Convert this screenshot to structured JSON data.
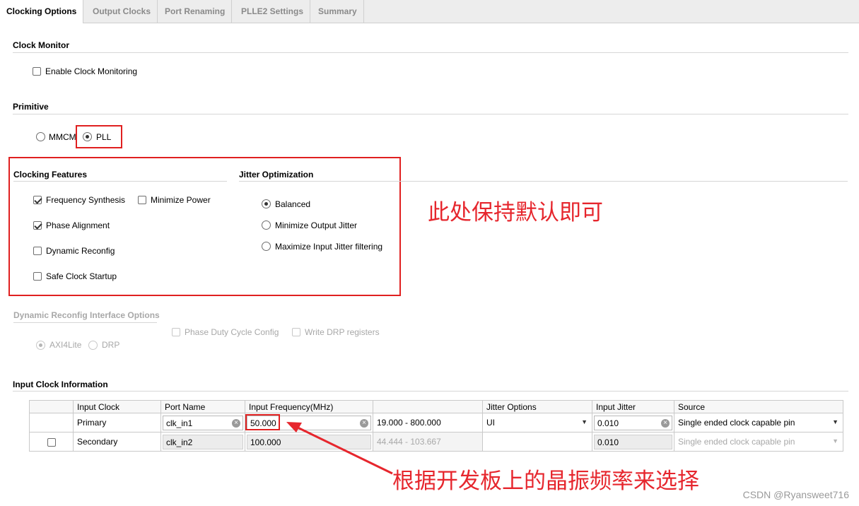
{
  "tabs": [
    {
      "label": "Clocking Options",
      "active": true
    },
    {
      "label": "Output Clocks",
      "active": false
    },
    {
      "label": "Port Renaming",
      "active": false
    },
    {
      "label": "PLLE2 Settings",
      "active": false
    },
    {
      "label": "Summary",
      "active": false
    }
  ],
  "clock_monitor": {
    "title": "Clock Monitor",
    "enable_label": "Enable Clock Monitoring",
    "enabled": false
  },
  "primitive": {
    "title": "Primitive",
    "options": [
      "MMCM",
      "PLL"
    ],
    "selected": "PLL"
  },
  "clocking_features": {
    "title": "Clocking Features",
    "frequency_synthesis": "Frequency Synthesis",
    "minimize_power": "Minimize Power",
    "phase_alignment": "Phase Alignment",
    "dynamic_reconfig": "Dynamic Reconfig",
    "safe_clock_startup": "Safe Clock Startup"
  },
  "jitter_optimization": {
    "title": "Jitter Optimization",
    "balanced": "Balanced",
    "minimize_output_jitter": "Minimize Output Jitter",
    "maximize_input_jitter": "Maximize Input Jitter filtering",
    "selected": "Balanced"
  },
  "drp": {
    "title": "Dynamic Reconfig Interface Options",
    "phase_duty": "Phase Duty Cycle Config",
    "write_drp": "Write DRP registers",
    "axi4lite": "AXI4Lite",
    "drp_label": "DRP"
  },
  "input_clock": {
    "title": "Input Clock Information",
    "headers": {
      "input_clock": "Input Clock",
      "port_name": "Port Name",
      "input_freq": "Input Frequency(MHz)",
      "jitter_options": "Jitter Options",
      "input_jitter": "Input Jitter",
      "source": "Source"
    },
    "primary": {
      "name": "Primary",
      "port": "clk_in1",
      "freq": "50.000",
      "range": "19.000 - 800.000",
      "jitter_option": "UI",
      "jitter": "0.010",
      "source": "Single ended clock capable pin"
    },
    "secondary": {
      "name": "Secondary",
      "port": "clk_in2",
      "freq": "100.000",
      "range": "44.444 - 103.667",
      "jitter": "0.010",
      "source": "Single ended clock capable pin"
    }
  },
  "annotations": {
    "keep_default": "此处保持默认即可",
    "choose_by_board": "根据开发板上的晶振频率来选择"
  },
  "watermark": "CSDN @Ryansweet716",
  "colors": {
    "annotation_red": "#e6262d"
  }
}
